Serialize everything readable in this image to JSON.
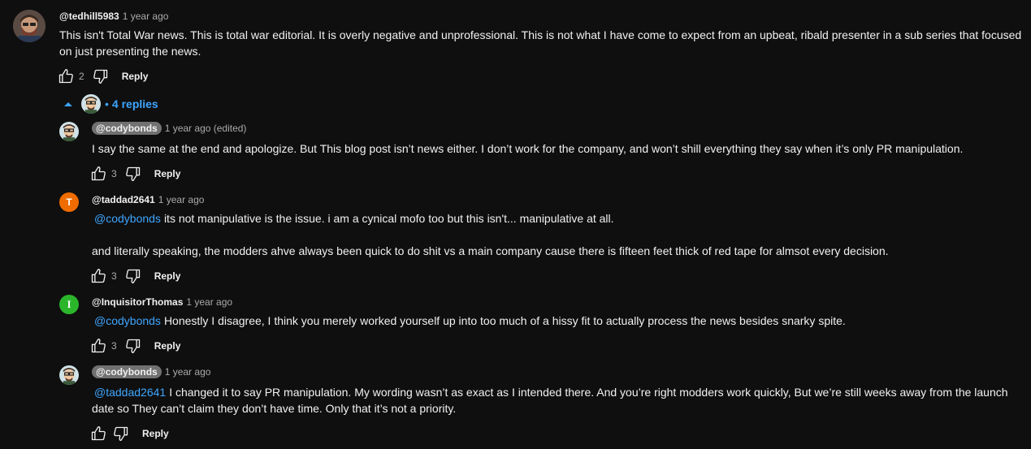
{
  "top_comment": {
    "author": "@tedhill5983",
    "time": "1 year ago",
    "text": "This isn't Total War news. This is total war editorial. It is overly negative and unprofessional. This is not what I have come to expect from an upbeat, ribald presenter in a sub series that focused on just presenting the news.",
    "likes": "2",
    "reply_label": "Reply"
  },
  "replies_toggle": {
    "label": "4 replies",
    "dot": "•"
  },
  "replies": [
    {
      "author": "@codybonds",
      "time": "1 year ago (edited)",
      "text": "I say the same at the end and apologize. But This blog post isn’t news either. I don’t work for the company, and won’t shill everything they say when it’s only PR manipulation.",
      "likes": "3",
      "reply_label": "Reply"
    },
    {
      "author": "@taddad2641",
      "avatar_letter": "T",
      "time": "1 year ago",
      "mention": "@codybonds",
      "text": "its not manipulative is the issue. i am a cynical mofo too but this isn't... manipulative at all.",
      "text2": "and literally speaking, the modders ahve always been quick to do shit vs a main company cause there is fifteen feet thick of red tape for almsot every decision.",
      "likes": "3",
      "reply_label": "Reply"
    },
    {
      "author": "@InquisitorThomas",
      "avatar_letter": "I",
      "time": "1 year ago",
      "mention": "@codybonds",
      "text": "Honestly I disagree, I think you merely worked yourself up into too much of a hissy fit to actually process the news besides snarky spite.",
      "likes": "3",
      "reply_label": "Reply"
    },
    {
      "author": "@codybonds",
      "time": "1 year ago",
      "mention": "@taddad2641",
      "text": "I changed it to say PR manipulation. My wording wasn’t as exact as I intended there. And you’re right modders work quickly, But we’re still weeks away from the launch date so They  can’t claim they don’t have time. Only that it’s not a priority.",
      "likes": "",
      "reply_label": "Reply"
    }
  ],
  "colors": {
    "background": "#0f0f0f",
    "link": "#3ea6ff",
    "taddad_avatar": "#ef6c00",
    "inquisitor_avatar": "#2bb52b"
  }
}
